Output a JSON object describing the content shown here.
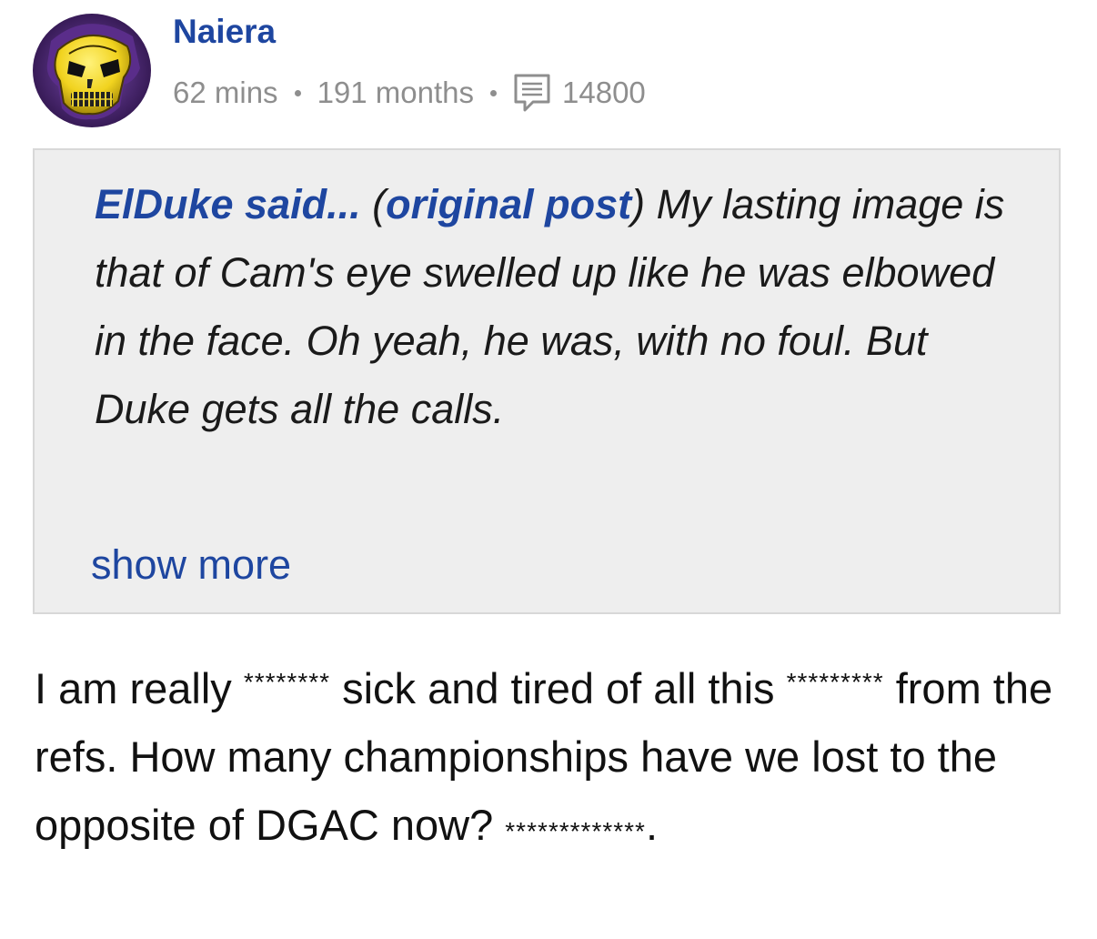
{
  "post": {
    "username": "Naiera",
    "time": "62 mins",
    "member_duration": "191 months",
    "post_count": "14800"
  },
  "quote": {
    "author_said": "ElDuke said...",
    "open_paren": "(",
    "original_post_link": "original post",
    "close_paren": ")",
    "text": " My lasting image is that of Cam's eye swelled up like he was elbowed in the face. Oh yeah, he was, with no foul. But Duke gets all the calls.",
    "show_more": "show more"
  },
  "body": {
    "part1": "I am really ",
    "censor1": "********",
    "part2": " sick and tired of all this ",
    "censor2": "*********",
    "part3": " from the refs. How many championships have we lost to the opposite of DGAC now? ",
    "censor3": "*************",
    "part4": "."
  },
  "colors": {
    "link": "#1e46a0",
    "meta": "#8e8e8e",
    "quote_bg": "#eeeeee"
  },
  "icons": {
    "avatar": "skeletor-avatar",
    "post_count": "document-icon"
  }
}
